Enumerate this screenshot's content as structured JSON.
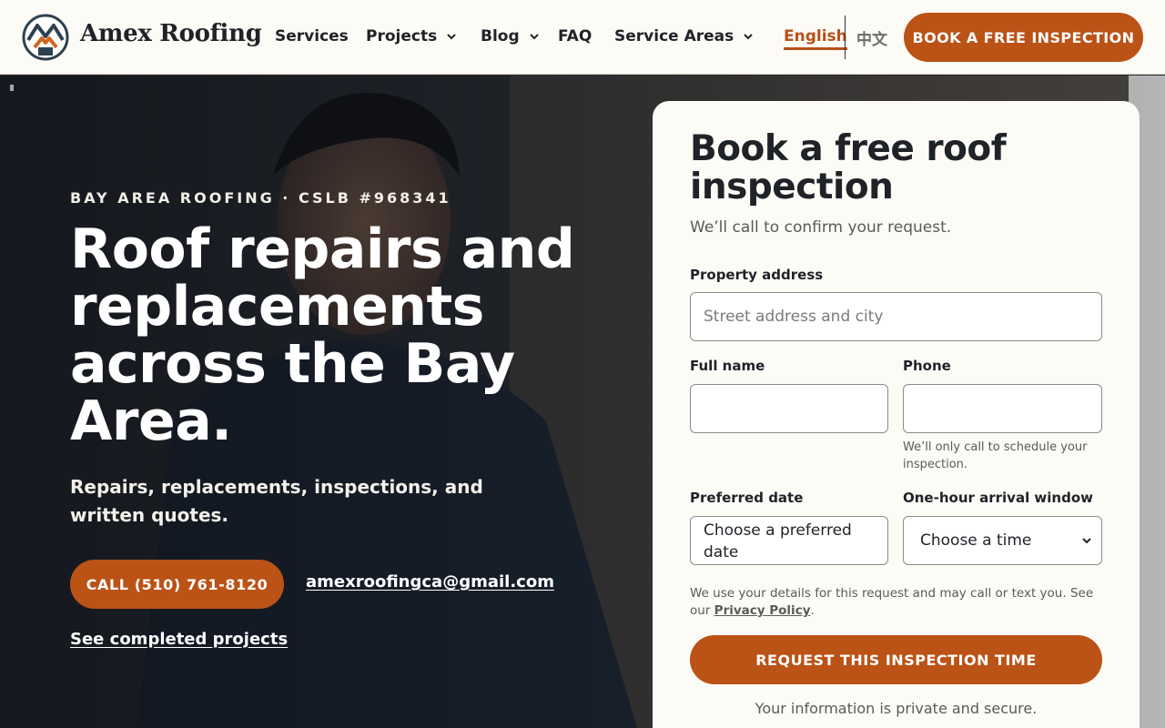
{
  "header": {
    "brand": "Amex Roofing",
    "nav": [
      {
        "label": "Services"
      },
      {
        "label": "Projects"
      },
      {
        "label": "Blog"
      },
      {
        "label": "FAQ"
      },
      {
        "label": "Service Areas"
      }
    ],
    "lang_en": "English",
    "lang_zh": "中文",
    "book_button": "BOOK A FREE INSPECTION"
  },
  "hero": {
    "eyebrow": "BAY AREA ROOFING · CSLB #968341",
    "title": "Roof repairs and replacements across the Bay Area.",
    "subtitle": "Repairs, replacements, inspections, and written quotes.",
    "call_button": "CALL (510) 761-8120",
    "email": "amexroofingca@gmail.com",
    "projects_link": "See completed projects"
  },
  "form": {
    "title": "Book a free roof inspection",
    "subtitle": "We’ll call to confirm your request.",
    "address_label": "Property address",
    "address_placeholder": "Street address and city",
    "name_label": "Full name",
    "phone_label": "Phone",
    "phone_helper": "We’ll only call to schedule your inspection.",
    "date_label": "Preferred date",
    "date_placeholder": "Choose a preferred date",
    "window_label": "One-hour arrival window",
    "window_value": "Choose a time",
    "consent_text": "We use your details for this request and may call or text you. See our ",
    "privacy_link": "Privacy Policy",
    "consent_end": ".",
    "submit": "REQUEST THIS INSPECTION TIME",
    "secure_note": "Your information is private and secure."
  },
  "colors": {
    "accent": "#bb5216",
    "header_bg": "#fdfbf6",
    "text_dark": "#1f2328"
  }
}
